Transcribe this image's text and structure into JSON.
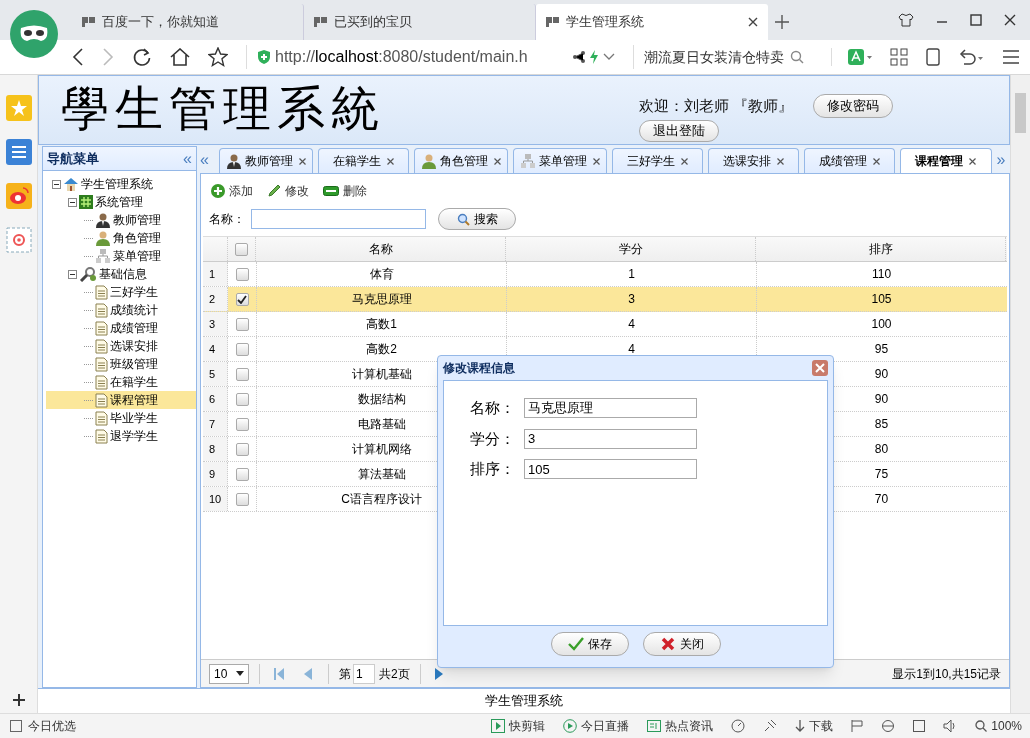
{
  "browser": {
    "tabs": [
      {
        "label": "百度一下，你就知道",
        "selected": false
      },
      {
        "label": "已买到的宝贝",
        "selected": false
      },
      {
        "label": "学生管理系统",
        "selected": true
      }
    ],
    "url": {
      "scheme": "http://",
      "host": "localhost",
      "rest": ":8080/student/main.h"
    },
    "search_value": "潮流夏日女装清仓特卖"
  },
  "header": {
    "logo": "學生管理系統",
    "welcome": "欢迎：刘老师 『教师』",
    "change_password": "修改密码",
    "logout": "退出登陆"
  },
  "nav": {
    "title": "导航菜单",
    "collapse": "«",
    "tree": [
      {
        "label": "学生管理系统",
        "kind": "house",
        "expanded": true,
        "selected": false,
        "children": [
          {
            "label": "系统管理",
            "kind": "hash",
            "expanded": true,
            "selected": false,
            "children": [
              {
                "label": "教师管理",
                "kind": "teacher",
                "selected": false
              },
              {
                "label": "角色管理",
                "kind": "person",
                "selected": false
              },
              {
                "label": "菜单管理",
                "kind": "org",
                "selected": false
              }
            ]
          },
          {
            "label": "基础信息",
            "kind": "tools",
            "expanded": true,
            "selected": false,
            "children": [
              {
                "label": "三好学生",
                "kind": "page",
                "selected": false
              },
              {
                "label": "成绩统计",
                "kind": "page",
                "selected": false
              },
              {
                "label": "成绩管理",
                "kind": "page",
                "selected": false
              },
              {
                "label": "选课安排",
                "kind": "page",
                "selected": false
              },
              {
                "label": "班级管理",
                "kind": "page",
                "selected": false
              },
              {
                "label": "在籍学生",
                "kind": "page",
                "selected": false
              },
              {
                "label": "课程管理",
                "kind": "page",
                "selected": true
              },
              {
                "label": "毕业学生",
                "kind": "page",
                "selected": false
              },
              {
                "label": "退学学生",
                "kind": "page",
                "selected": false
              }
            ]
          }
        ]
      }
    ]
  },
  "tabs": {
    "scroll_left": "«",
    "scroll_right": "»",
    "items": [
      {
        "label": "教师管理",
        "kind": "teacher",
        "selected": false
      },
      {
        "label": "在籍学生",
        "kind": "none",
        "selected": false
      },
      {
        "label": "角色管理",
        "kind": "person",
        "selected": false
      },
      {
        "label": "菜单管理",
        "kind": "org",
        "selected": false
      },
      {
        "label": "三好学生",
        "kind": "none",
        "selected": false
      },
      {
        "label": "选课安排",
        "kind": "none",
        "selected": false
      },
      {
        "label": "成绩管理",
        "kind": "none",
        "selected": false
      },
      {
        "label": "课程管理",
        "kind": "none",
        "selected": true
      }
    ]
  },
  "toolbar": [
    {
      "label": "添加",
      "kind": "add"
    },
    {
      "label": "修改",
      "kind": "edit"
    },
    {
      "label": "删除",
      "kind": "remove"
    }
  ],
  "search": {
    "label": "名称：",
    "button": "搜索"
  },
  "table": {
    "select_all_checked": false,
    "columns": [
      "名称",
      "学分",
      "排序"
    ],
    "rows": [
      {
        "index": "1",
        "checked": false,
        "selected": false,
        "name": "体育",
        "credit": "1",
        "order": "110"
      },
      {
        "index": "2",
        "checked": true,
        "selected": true,
        "name": "马克思原理",
        "credit": "3",
        "order": "105"
      },
      {
        "index": "3",
        "checked": false,
        "selected": false,
        "name": "高数1",
        "credit": "4",
        "order": "100"
      },
      {
        "index": "4",
        "checked": false,
        "selected": false,
        "name": "高数2",
        "credit": "4",
        "order": "95"
      },
      {
        "index": "5",
        "checked": false,
        "selected": false,
        "name": "计算机基础",
        "order": "90"
      },
      {
        "index": "6",
        "checked": false,
        "selected": false,
        "name": "数据结构",
        "order": "90"
      },
      {
        "index": "7",
        "checked": false,
        "selected": false,
        "name": "电路基础",
        "order": "85"
      },
      {
        "index": "8",
        "checked": false,
        "selected": false,
        "name": "计算机网络",
        "order": "80"
      },
      {
        "index": "9",
        "checked": false,
        "selected": false,
        "name": "算法基础",
        "order": "75"
      },
      {
        "index": "10",
        "checked": false,
        "selected": false,
        "name": "C语言程序设计",
        "order": "70"
      }
    ]
  },
  "pager": {
    "page_size": "10",
    "before": "第",
    "page": "1",
    "after": "共2页",
    "summary": "显示1到10,共15记录"
  },
  "dialog": {
    "title": "修改课程信息",
    "fields": [
      {
        "label": "名称：",
        "value": "马克思原理"
      },
      {
        "label": "学分：",
        "value": "3"
      },
      {
        "label": "排序：",
        "value": "105"
      }
    ],
    "buttons": [
      {
        "label": "保存",
        "kind": "save"
      },
      {
        "label": "关闭",
        "kind": "close"
      }
    ]
  },
  "footer": "学生管理系统",
  "status_bar": {
    "left": "今日优选",
    "items": [
      {
        "label": "快剪辑"
      },
      {
        "label": "今日直播"
      },
      {
        "label": "热点资讯"
      }
    ],
    "download": "下载",
    "zoom": "100%"
  }
}
